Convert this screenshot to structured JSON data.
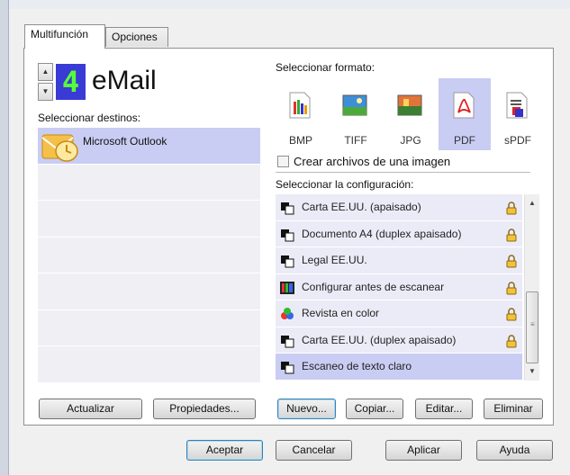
{
  "tabs": [
    {
      "label": "Multifunción"
    },
    {
      "label": "Opciones"
    }
  ],
  "selector": {
    "lcd_value": "4",
    "app_name": "eMail"
  },
  "destinations": {
    "heading": "Seleccionar destinos:",
    "items": [
      {
        "label": "Microsoft Outlook",
        "icon": "outlook-icon"
      }
    ]
  },
  "formats": {
    "heading": "Seleccionar formato:",
    "items": [
      {
        "label": "BMP",
        "icon": "bmp-icon"
      },
      {
        "label": "TIFF",
        "icon": "tiff-icon"
      },
      {
        "label": "JPG",
        "icon": "jpg-icon"
      },
      {
        "label": "PDF",
        "icon": "pdf-icon",
        "selected": true
      },
      {
        "label": "sPDF",
        "icon": "spdf-icon"
      }
    ],
    "single_file_checkbox": "Crear archivos de una imagen"
  },
  "configurations": {
    "heading": "Seleccionar la configuración:",
    "items": [
      {
        "label": "Carta EE.UU. (apaisado)",
        "icon": "scan-page-icon",
        "locked": true
      },
      {
        "label": "Documento A4 (duplex apaisado)",
        "icon": "scan-page-icon",
        "locked": true
      },
      {
        "label": "Legal EE.UU.",
        "icon": "scan-page-icon",
        "locked": true
      },
      {
        "label": "Configurar antes de escanear",
        "icon": "color-config-icon",
        "locked": true
      },
      {
        "label": "Revista en color",
        "icon": "color-blocks-icon",
        "locked": true
      },
      {
        "label": "Carta EE.UU. (duplex apaisado)",
        "icon": "scan-page-icon",
        "locked": true
      },
      {
        "label": "Escaneo de texto claro",
        "icon": "scan-page-icon",
        "locked": false,
        "selected": true
      }
    ]
  },
  "buttons": {
    "refresh": "Actualizar",
    "properties": "Propiedades...",
    "new": "Nuevo...",
    "copy": "Copiar...",
    "edit": "Editar...",
    "delete": "Eliminar",
    "ok": "Aceptar",
    "cancel": "Cancelar",
    "apply": "Aplicar",
    "help": "Ayuda"
  },
  "colors": {
    "selection": "#c9cdf3",
    "lcd_background": "#3a3ad6",
    "lcd_digit": "#56ff38"
  }
}
